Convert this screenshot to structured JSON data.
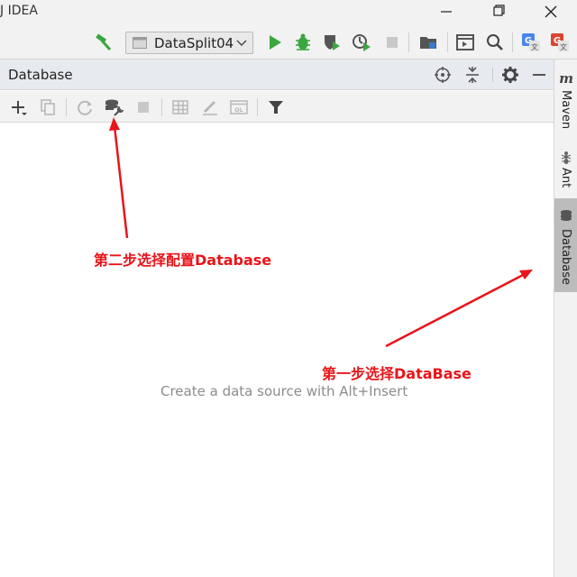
{
  "window": {
    "title": "J IDEA",
    "controls": [
      "minimize-icon",
      "maximize-icon",
      "close-icon"
    ]
  },
  "toolbar": {
    "run_config": "DataSplit04",
    "icons": [
      "build-hammer-icon",
      "run-config-icon",
      "chevron-down-icon",
      "run-icon",
      "debug-icon",
      "coverage-icon",
      "profile-icon",
      "stop-icon",
      "project-structure-icon",
      "terminal-icon",
      "search-icon",
      "translate-icon",
      "google-translate-icon"
    ]
  },
  "tool_window": {
    "title": "Database",
    "header_icons": [
      "target-icon",
      "collapse-icon",
      "gear-icon",
      "minimize-icon"
    ],
    "toolbar_icons": [
      "add-icon",
      "copy-icon",
      "refresh-icon",
      "data-source-properties-icon",
      "stop-icon",
      "table-icon",
      "edit-icon",
      "console-icon",
      "filter-icon"
    ],
    "empty_text": "Create a data source with Alt+Insert"
  },
  "right_stripe": {
    "tabs": [
      {
        "label": "Maven",
        "icon": "maven-icon",
        "active": false
      },
      {
        "label": "Ant",
        "icon": "ant-icon",
        "active": false
      },
      {
        "label": "Database",
        "icon": "database-icon",
        "active": true
      }
    ]
  },
  "annotations": {
    "step2": "第二步选择配置Database",
    "step1": "第一步选择DataBase",
    "color": "#e8141a"
  },
  "colors": {
    "run_green": "#3aa63f",
    "accent_red": "#e8141a"
  }
}
